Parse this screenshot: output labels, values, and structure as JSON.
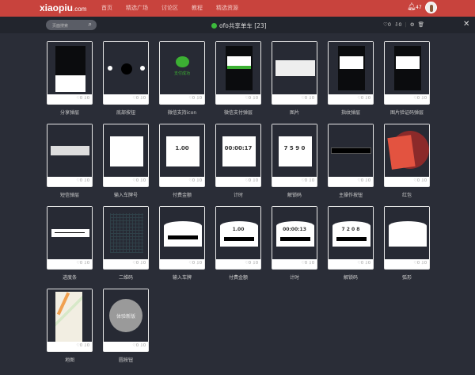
{
  "header": {
    "logo": "xiaopiu",
    "logo_suffix": ".com",
    "nav": [
      "首页",
      "精选广场",
      "讨论区",
      "教程",
      "精选资源"
    ],
    "notifications": "47"
  },
  "subbar": {
    "search_placeholder": "页面搜索",
    "title": "ofo共享单车 [23]",
    "likes": "♡0",
    "downloads": "⇩0"
  },
  "cards": [
    {
      "label": "分享弹层",
      "kind": "share",
      "likes": "0",
      "downloads": "0"
    },
    {
      "label": "底部按钮",
      "kind": "bottom",
      "likes": "0",
      "downloads": "0"
    },
    {
      "label": "微信支持icon",
      "kind": "wechat",
      "text": "支付成功",
      "likes": "0",
      "downloads": "0"
    },
    {
      "label": "微信支付弹层",
      "kind": "paydlg",
      "likes": "0",
      "downloads": "0"
    },
    {
      "label": "图片",
      "kind": "image",
      "likes": "0",
      "downloads": "0"
    },
    {
      "label": "指纹弹层",
      "kind": "finger",
      "likes": "0",
      "downloads": "0"
    },
    {
      "label": "图片验证码弹层",
      "kind": "captcha",
      "likes": "0",
      "downloads": "0"
    },
    {
      "label": "短信弹层",
      "kind": "sms",
      "likes": "0",
      "downloads": "0"
    },
    {
      "label": "输入车牌号",
      "kind": "plate",
      "likes": "0",
      "downloads": "0"
    },
    {
      "label": "付费金额",
      "kind": "amount",
      "text": "1.00",
      "likes": "0",
      "downloads": "0"
    },
    {
      "label": "计时",
      "kind": "timer",
      "text": "00:00:17",
      "likes": "0",
      "downloads": "0"
    },
    {
      "label": "解锁码",
      "kind": "code",
      "text": "7 5 9 0",
      "likes": "0",
      "downloads": "0"
    },
    {
      "label": "主操作按钮",
      "kind": "mainbtn",
      "likes": "0",
      "downloads": "0"
    },
    {
      "label": "红包",
      "kind": "redpack",
      "likes": "0",
      "downloads": "0"
    },
    {
      "label": "进度条",
      "kind": "progress",
      "likes": "0",
      "downloads": "0"
    },
    {
      "label": "二维码",
      "kind": "qr",
      "likes": "0",
      "downloads": "0"
    },
    {
      "label": "输入车牌",
      "kind": "arcplate",
      "likes": "0",
      "downloads": "0"
    },
    {
      "label": "付费金额",
      "kind": "arcamount",
      "text": "1.00",
      "likes": "0",
      "downloads": "0"
    },
    {
      "label": "计时",
      "kind": "arctimer",
      "text": "00:00:13",
      "likes": "0",
      "downloads": "0"
    },
    {
      "label": "解锁码",
      "kind": "arccode",
      "text": "7 2 0 8",
      "likes": "0",
      "downloads": "0"
    },
    {
      "label": "弧形",
      "kind": "arc",
      "likes": "0",
      "downloads": "0"
    },
    {
      "label": "地图",
      "kind": "map",
      "likes": "0",
      "downloads": "0"
    },
    {
      "label": "圆按钮",
      "kind": "circle",
      "text": "体验新版",
      "likes": "0",
      "downloads": "0"
    }
  ]
}
